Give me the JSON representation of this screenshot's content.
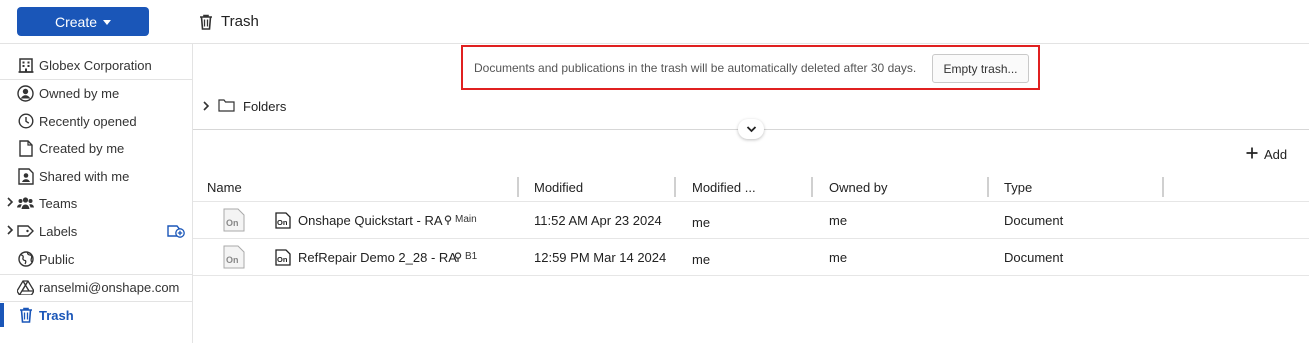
{
  "topbar": {
    "create_label": "Create",
    "page_title": "Trash"
  },
  "sidebar": {
    "items": [
      {
        "label": "Globex Corporation",
        "icon": "building-icon"
      },
      {
        "label": "Owned by me",
        "icon": "user-circle-icon"
      },
      {
        "label": "Recently opened",
        "icon": "clock-icon"
      },
      {
        "label": "Created by me",
        "icon": "document-icon"
      },
      {
        "label": "Shared with me",
        "icon": "shared-user-icon"
      },
      {
        "label": "Teams",
        "icon": "team-icon"
      },
      {
        "label": "Labels",
        "icon": "label-icon"
      },
      {
        "label": "Public",
        "icon": "globe-icon"
      },
      {
        "label": "ranselmi@onshape.com",
        "icon": "drive-icon"
      },
      {
        "label": "Trash",
        "icon": "trash-icon"
      }
    ]
  },
  "notice": {
    "text": "Documents and publications in the trash will be automatically deleted after 30 days.",
    "button": "Empty trash..."
  },
  "folders": {
    "label": "Folders"
  },
  "toolbar": {
    "add_label": "Add"
  },
  "table": {
    "columns": [
      "Name",
      "Modified",
      "Modified ...",
      "Owned by",
      "Type"
    ],
    "rows": [
      {
        "name": "Onshape Quickstart - RA",
        "branch": "Main",
        "modified": "11:52 AM Apr 23 2024",
        "modified_by": "me",
        "owned_by": "me",
        "type": "Document"
      },
      {
        "name": "RefRepair Demo 2_28 - RA",
        "branch": "B1",
        "modified": "12:59 PM Mar 14 2024",
        "modified_by": "me",
        "owned_by": "me",
        "type": "Document"
      }
    ]
  },
  "colors": {
    "accent": "#1a56b8",
    "notice_border": "#e02020"
  }
}
